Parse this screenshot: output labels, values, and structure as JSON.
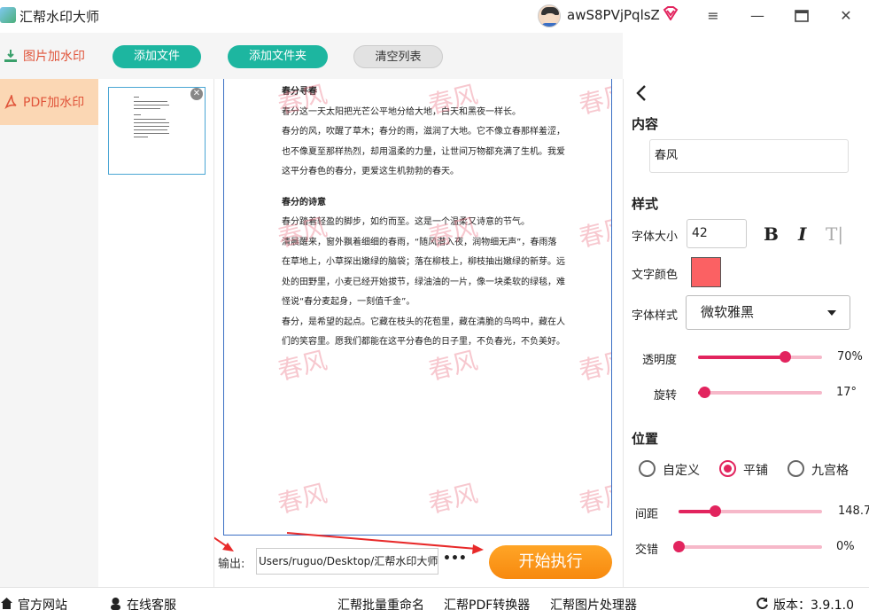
{
  "app": {
    "title": "汇帮水印大师"
  },
  "user": {
    "name": "awS8PVjPqlsZ"
  },
  "window": {
    "menu_icon": "menu-icon",
    "min_icon": "minimize-icon",
    "max_icon": "maximize-icon",
    "close_icon": "close-icon"
  },
  "sidebar": {
    "items": [
      {
        "label": "图片加水印",
        "icon": "image-watermark-icon"
      },
      {
        "label": "PDF加水印",
        "icon": "pdf-watermark-icon",
        "active": true
      }
    ]
  },
  "toolbar": {
    "add_file": "添加文件",
    "add_folder": "添加文件夹",
    "clear_list": "清空列表"
  },
  "document": {
    "heading1": "春分寻春",
    "para1": "春分这一天太阳把光芒公平地分给大地，白天和黑夜一样长。",
    "para2": "春分的风，吹醒了草木；春分的雨，滋润了大地。它不像立春那样羞涩，也不像夏至那样热烈，却用温柔的力量，让世间万物都充满了生机。我爱这平分春色的春分，更爱这生机勃勃的春天。",
    "heading2": "春分的诗意",
    "para3": "春分踏着轻盈的脚步，如约而至。这是一个温柔又诗意的节气。",
    "para4": "清晨醒来，窗外飘着细细的春雨，“随风潜入夜，润物细无声”，春雨落在草地上，小草探出嫩绿的脑袋；落在柳枝上，柳枝抽出嫩绿的新芽。远处的田野里，小麦已经开始拔节，绿油油的一片，像一块柔软的绿毯，难怪说“春分麦起身，一刻值千金”。",
    "para5": "春分，是希望的起点。它藏在枝头的花苞里，藏在清脆的鸟鸣中，藏在人们的笑容里。愿我们都能在这平分春色的日子里，不负春光，不负美好。",
    "watermark": "春风"
  },
  "output": {
    "label": "输出:",
    "path": "Users/ruguo/Desktop/汇帮水印大师",
    "more": "•••",
    "start": "开始执行"
  },
  "panel": {
    "content_title": "内容",
    "content_value": "春风",
    "style_title": "样式",
    "font_size_label": "字体大小",
    "font_size_value": "42",
    "bold": "B",
    "italic": "I",
    "text_style": "T|",
    "color_label": "文字颜色",
    "text_color": "#fb6163",
    "font_style_label": "字体样式",
    "font_style_value": "微软雅黑",
    "opacity_label": "透明度",
    "opacity_value": "70%",
    "opacity_fraction": 0.7,
    "rotation_label": "旋转",
    "rotation_value": "17°",
    "rotation_fraction": 0.05,
    "position_title": "位置",
    "radio_custom": "自定义",
    "radio_tile": "平铺",
    "radio_grid": "九宫格",
    "spacing_label": "间距",
    "spacing_value": "148.7",
    "spacing_fraction": 0.25,
    "stagger_label": "交错",
    "stagger_value": "0%",
    "stagger_fraction": 0.0
  },
  "footer": {
    "website": "官方网站",
    "service": "在线客服",
    "rename": "汇帮批量重命名",
    "pdf": "汇帮PDF转换器",
    "image": "汇帮图片处理器",
    "version": "版本：3.9.1.0"
  },
  "colors": {
    "accent": "#e2245e",
    "teal": "#1db6a0",
    "orange": "#f7890f",
    "sidebar_active": "#fbd7b4"
  }
}
